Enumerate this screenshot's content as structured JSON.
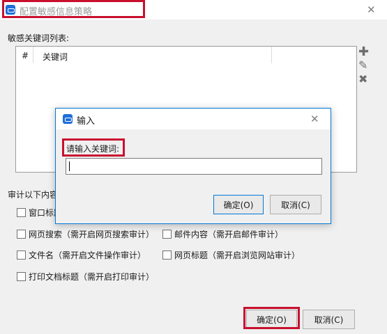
{
  "window": {
    "title": "配置敏感信息策略",
    "close_glyph": "✕",
    "keyword_list_label": "敏感关键词列表:",
    "columns": [
      "#",
      "关键词"
    ],
    "audit_label": "审计以下内容",
    "checkboxes": [
      "窗口标题",
      "网页搜索（需开启网页搜索审计）",
      "邮件内容（需开启邮件审计）",
      "文件名（需开启文件操作审计）",
      "网页标题（需开启浏览网站审计）",
      "打印文档标题（需开启打印审计）"
    ],
    "ok_label": "确定(O)",
    "cancel_label": "取消(C)"
  },
  "dialog": {
    "title": "输入",
    "close_glyph": "✕",
    "prompt": "请输入关键词:",
    "input_value": "",
    "ok_label": "确定(O)",
    "cancel_label": "取消(C)"
  },
  "icons": {
    "add": "add-icon",
    "edit": "pencil-icon",
    "delete": "delete-icon",
    "app": "app-icon",
    "close": "close-icon"
  },
  "colors": {
    "accent": "#0078d7",
    "highlight": "#c8102e",
    "app_icon": "#1e6fd9"
  }
}
